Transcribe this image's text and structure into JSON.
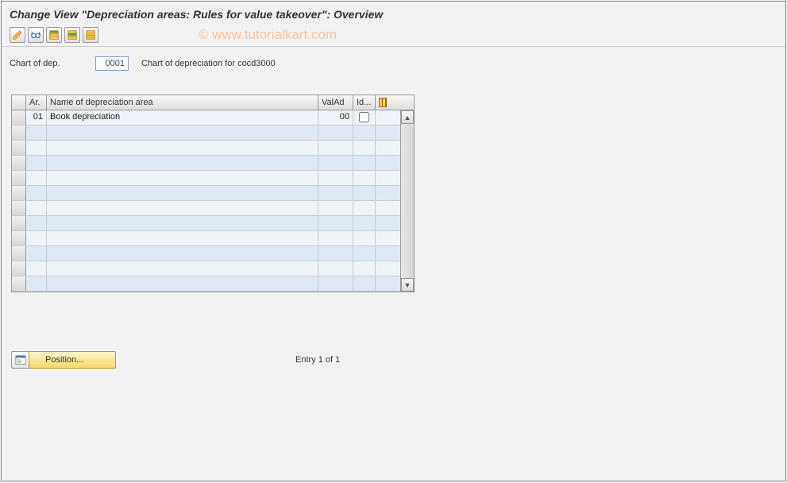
{
  "title": "Change View \"Depreciation areas: Rules for value takeover\": Overview",
  "watermark": "© www.tutorialkart.com",
  "toolbar": {
    "icons": [
      "pencil-icon",
      "glasses-icon",
      "select-all-icon",
      "select-block-icon",
      "deselect-all-icon"
    ]
  },
  "form": {
    "chart_label": "Chart of dep.",
    "chart_value": "0001",
    "chart_desc": "Chart of depreciation for cocd3000"
  },
  "table": {
    "headers": {
      "ar": "Ar.",
      "name": "Name of depreciation area",
      "valad": "ValAd",
      "id": "Id..."
    },
    "rows": [
      {
        "ar": "01",
        "name": "Book depreciation",
        "valad": "00",
        "id_checked": false
      },
      {
        "ar": "",
        "name": "",
        "valad": "",
        "id_checked": null
      },
      {
        "ar": "",
        "name": "",
        "valad": "",
        "id_checked": null
      },
      {
        "ar": "",
        "name": "",
        "valad": "",
        "id_checked": null
      },
      {
        "ar": "",
        "name": "",
        "valad": "",
        "id_checked": null
      },
      {
        "ar": "",
        "name": "",
        "valad": "",
        "id_checked": null
      },
      {
        "ar": "",
        "name": "",
        "valad": "",
        "id_checked": null
      },
      {
        "ar": "",
        "name": "",
        "valad": "",
        "id_checked": null
      },
      {
        "ar": "",
        "name": "",
        "valad": "",
        "id_checked": null
      },
      {
        "ar": "",
        "name": "",
        "valad": "",
        "id_checked": null
      },
      {
        "ar": "",
        "name": "",
        "valad": "",
        "id_checked": null
      },
      {
        "ar": "",
        "name": "",
        "valad": "",
        "id_checked": null
      }
    ]
  },
  "footer": {
    "position_label": "Position...",
    "entry_text": "Entry 1 of 1"
  }
}
